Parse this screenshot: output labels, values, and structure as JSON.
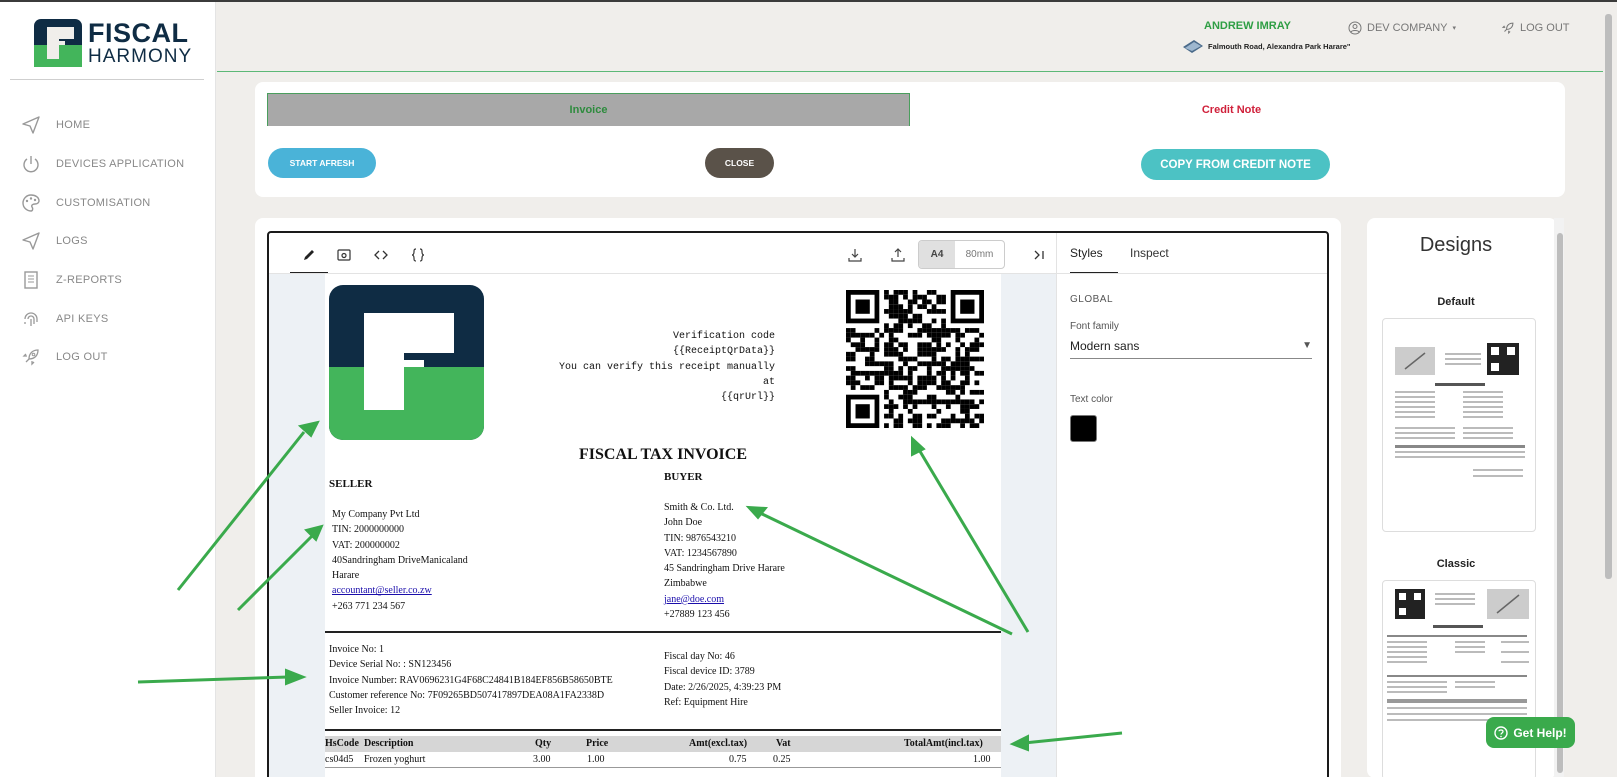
{
  "brand": {
    "name_top": "FISCAL",
    "name_bottom": "HARMONY"
  },
  "sidebar": {
    "items": [
      {
        "label": "HOME",
        "icon": "send-icon"
      },
      {
        "label": "DEVICES APPLICATION",
        "icon": "power-icon"
      },
      {
        "label": "CUSTOMISATION",
        "icon": "palette-icon"
      },
      {
        "label": "LOGS",
        "icon": "send-icon"
      },
      {
        "label": "Z-REPORTS",
        "icon": "document-icon"
      },
      {
        "label": "API KEYS",
        "icon": "fingerprint-icon"
      },
      {
        "label": "LOG OUT",
        "icon": "rocket-icon"
      }
    ]
  },
  "header": {
    "user_name": "ANDREW IMRAY",
    "user_address": "Falmouth Road, Alexandra Park Harare\"",
    "company": "DEV COMPANY",
    "logout": "LOG OUT"
  },
  "tabs": {
    "invoice": "Invoice",
    "credit_note": "Credit Note"
  },
  "actions": {
    "start_afresh": "START AFRESH",
    "close": "CLOSE",
    "copy_from_credit_note": "COPY FROM CREDIT NOTE"
  },
  "editor": {
    "size_a4": "A4",
    "size_80mm": "80mm",
    "styles_tab": "Styles",
    "inspect_tab": "Inspect",
    "global_label": "GLOBAL",
    "font_family_label": "Font family",
    "font_family_value": "Modern sans",
    "text_color_label": "Text color",
    "text_color": "#000000"
  },
  "invoice": {
    "verification": [
      "Verification code",
      "{{ReceiptQrData}}",
      "You can verify this receipt manually at",
      "{{qrUrl}}"
    ],
    "title": "FISCAL TAX INVOICE",
    "seller_label": "SELLER",
    "buyer_label": "BUYER",
    "seller": {
      "name": "My Company Pvt Ltd",
      "tin": "TIN: 2000000000",
      "vat": "VAT: 200000002",
      "address1": "40Sandringham DriveManicaland",
      "address2": "Harare",
      "email": "accountant@seller.co.zw",
      "phone": "+263 771 234 567"
    },
    "buyer": {
      "name": "Smith & Co. Ltd.",
      "contact": "John Doe",
      "tin": "TIN: 9876543210",
      "vat": "VAT: 1234567890",
      "address": "45 Sandringham Drive Harare",
      "country": "Zimbabwe",
      "email": "jane@doe.com",
      "phone": "+27889 123 456"
    },
    "meta_left": {
      "invoice_no": "Invoice No: 1",
      "device_serial": "Device Serial No: : SN123456",
      "invoice_number": "Invoice Number: RAV0696231G4F68C24841B184EF856B58650BTE",
      "customer_ref": "Customer reference No: 7F09265BD507417897DEA08A1FA2338D",
      "seller_invoice": "Seller Invoice: 12"
    },
    "meta_right": {
      "fiscal_day": "Fiscal day No: 46",
      "fiscal_device": "Fiscal device ID: 3789",
      "date": "Date: 2/26/2025, 4:39:23 PM",
      "ref": "Ref: Equipment Hire"
    },
    "table": {
      "headers": [
        "HsCode",
        "Description",
        "Qty",
        "Price",
        "Amt(excl.tax)",
        "Vat",
        "TotalAmt(incl.tax)"
      ],
      "rows": [
        [
          "cs04d5",
          "Frozen yoghurt",
          "3.00",
          "1.00",
          "0.75",
          "0.25",
          "1.00"
        ]
      ]
    }
  },
  "designs": {
    "title": "Designs",
    "items": [
      {
        "name": "Default"
      },
      {
        "name": "Classic"
      }
    ]
  },
  "help": {
    "label": "Get Help!"
  }
}
